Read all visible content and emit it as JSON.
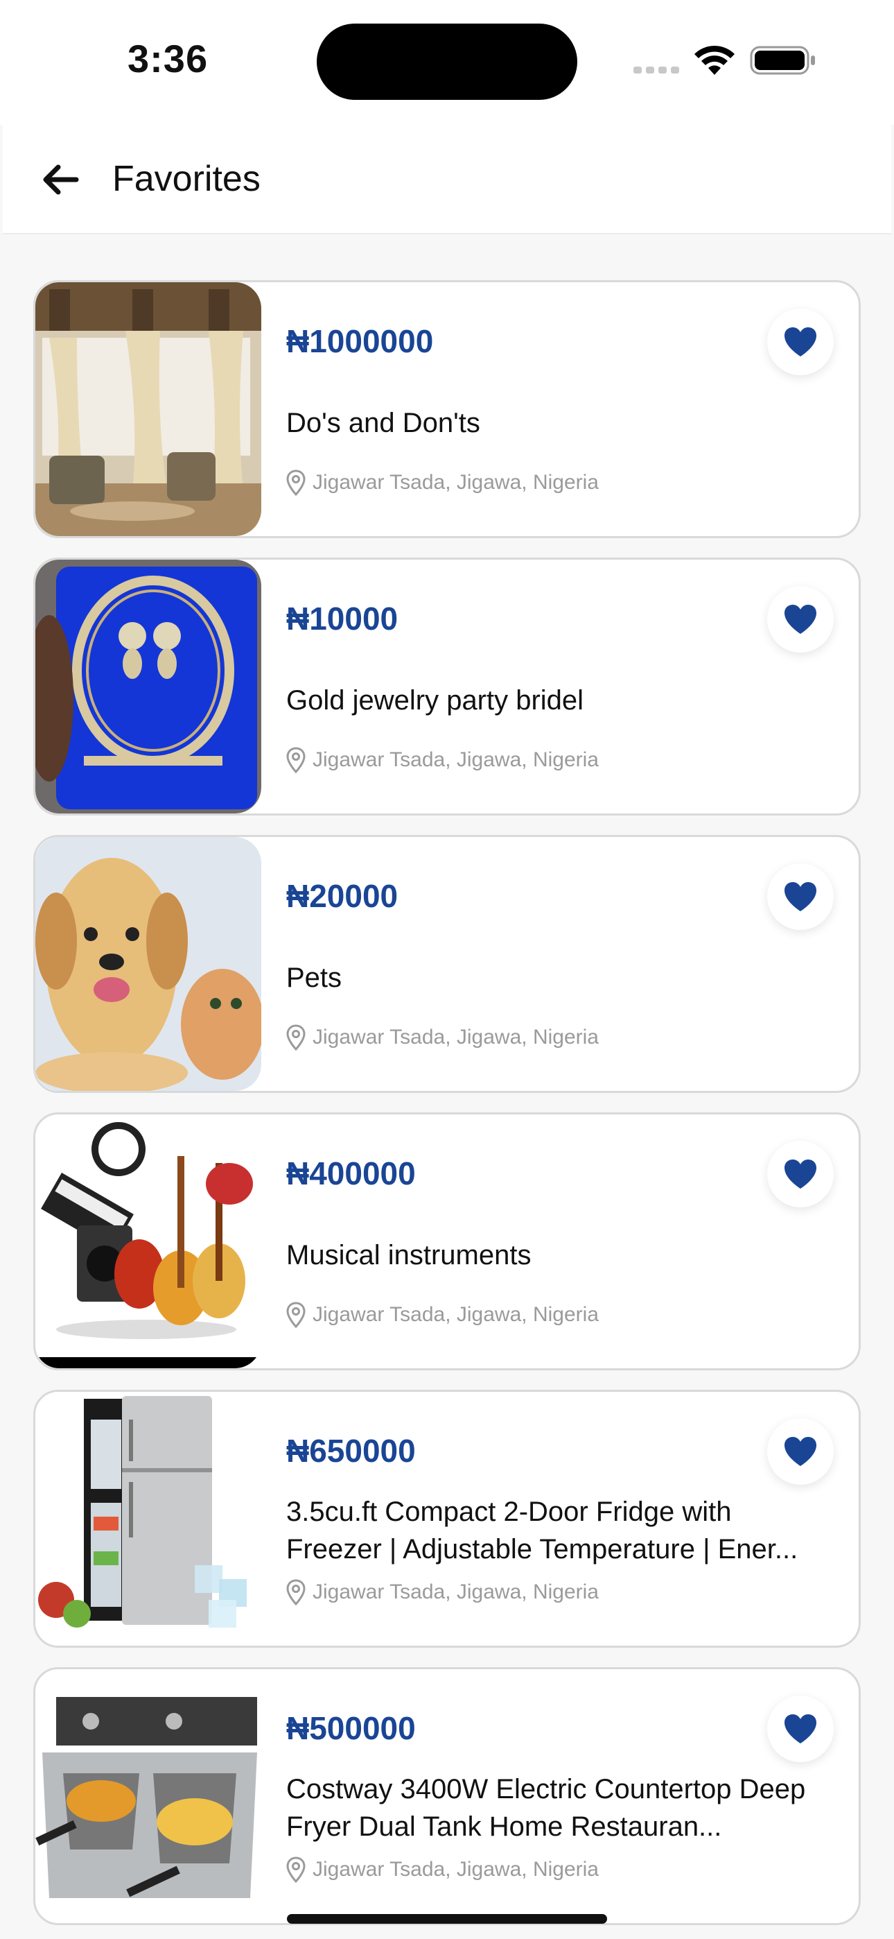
{
  "status_bar": {
    "time": "3:36"
  },
  "header": {
    "title": "Favorites",
    "back_icon": "arrow-left-icon"
  },
  "colors": {
    "price": "#1a4595",
    "heart": "#1a4595",
    "location": "#9a9a9a"
  },
  "favorites": [
    {
      "price": "₦1000000",
      "title": "Do's and Don'ts",
      "location": "Jigawar Tsada, Jigawa, Nigeria",
      "image": "living-room-curtains"
    },
    {
      "price": "₦10000",
      "title": "Gold jewelry  party bridel",
      "location": "Jigawar Tsada, Jigawa, Nigeria",
      "image": "jewelry-set-blue-box"
    },
    {
      "price": "₦20000",
      "title": "Pets",
      "location": "Jigawar Tsada, Jigawa, Nigeria",
      "image": "puppy-and-kitten"
    },
    {
      "price": "₦400000",
      "title": "Musical instruments",
      "location": "Jigawar Tsada, Jigawa, Nigeria",
      "image": "musical-instruments"
    },
    {
      "price": "₦650000",
      "title": "3.5cu.ft Compact 2-Door Fridge with Freezer | Adjustable Temperature | Ener...",
      "location": "Jigawar Tsada, Jigawa, Nigeria",
      "image": "compact-fridge"
    },
    {
      "price": "₦500000",
      "title": "Costway 3400W Electric Countertop Deep Fryer Dual Tank Home Restauran...",
      "location": "Jigawar Tsada, Jigawa, Nigeria",
      "image": "deep-fryer"
    }
  ]
}
